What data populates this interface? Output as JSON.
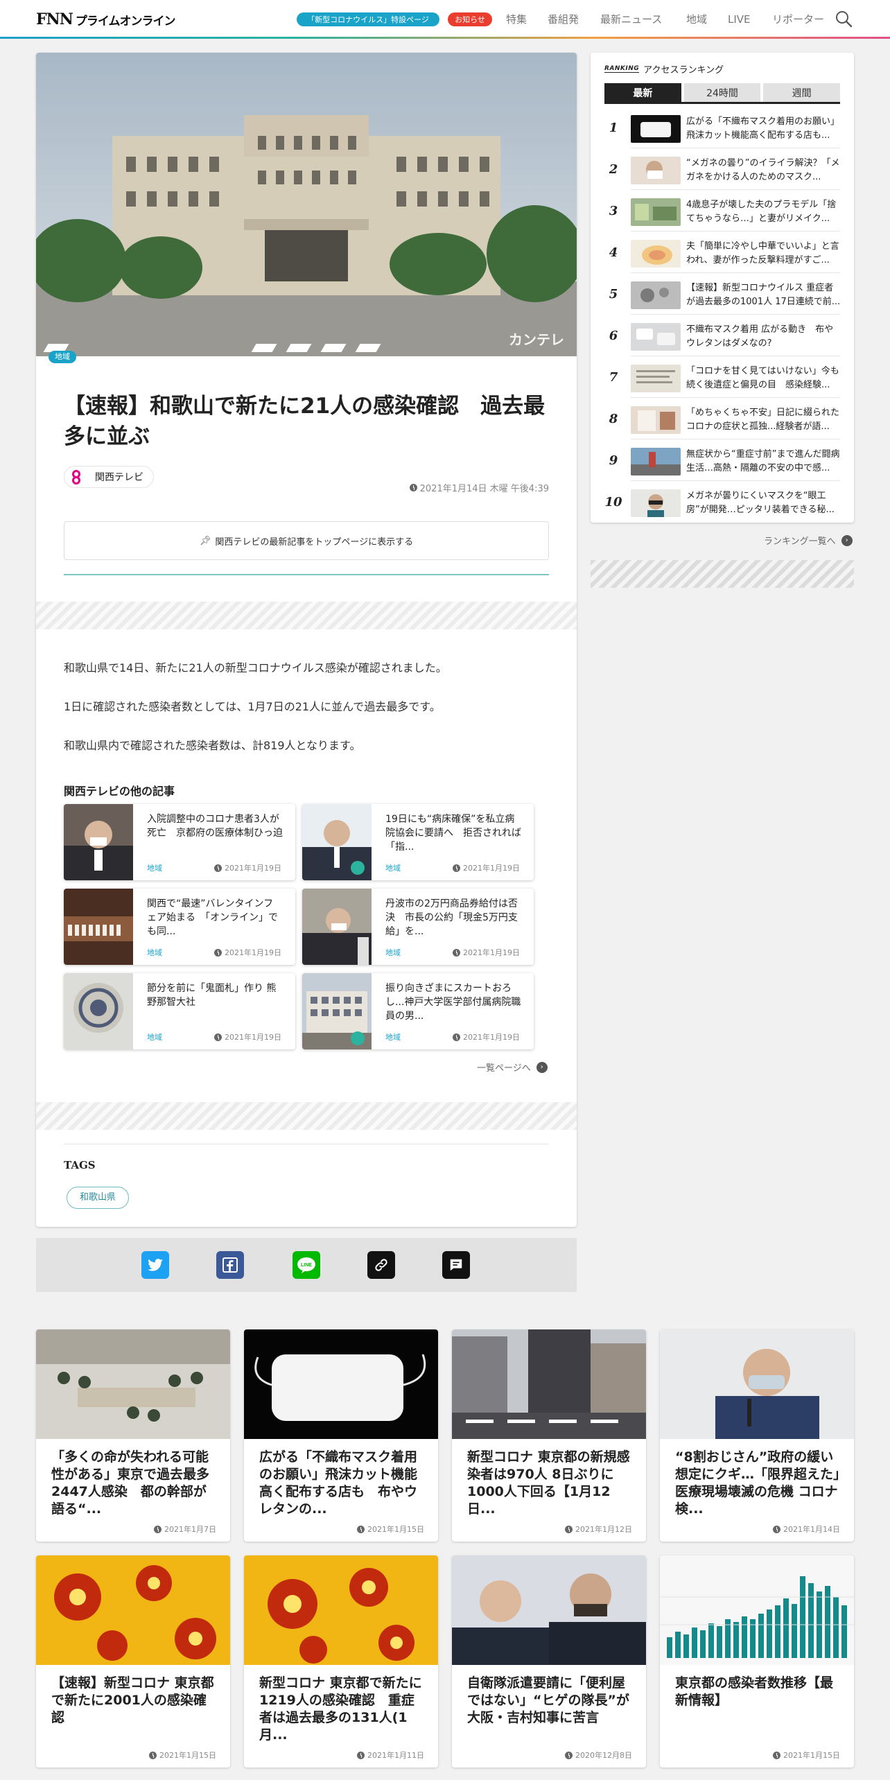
{
  "header": {
    "logo_fnn": "FNN",
    "logo_name": "プライムオンライン",
    "corona_link": "「新型コロナウイルス」特設ページ",
    "notice": "お知らせ",
    "nav": [
      "特集",
      "番組発",
      "最新ニュース",
      "地域",
      "LIVE",
      "リポーター"
    ],
    "search_icon": "search-icon"
  },
  "article": {
    "category": "地域",
    "title": "【速報】和歌山で新たに21人の感染確認　過去最多に並ぶ",
    "source": "関西テレビ",
    "date": "2021年1月14日 木曜 午後4:39",
    "follow_button": "関西テレビの最新記事をトップページに表示する",
    "paragraphs": [
      "和歌山県で14日、新たに21人の新型コロナウイルス感染が確認されました。",
      "1日に確認された感染者数としては、1月7日の21人に並んで過去最多です。",
      "和歌山県内で確認された感染者数は、計819人となります。"
    ],
    "hero_watermark": "カンテレ"
  },
  "related": {
    "heading": "関西テレビの他の記事",
    "items": [
      {
        "title": "入院調整中のコロナ患者3人が死亡　京都府の医療体制ひっ迫",
        "category": "地域",
        "date": "2021年1月19日"
      },
      {
        "title": "19日にも“病床確保”を私立病院協会に要請へ　拒否されれば「指...",
        "category": "地域",
        "date": "2021年1月19日"
      },
      {
        "title": "関西で“最速”バレンタインフェア始まる　「オンライン」でも同...",
        "category": "地域",
        "date": "2021年1月19日"
      },
      {
        "title": "丹波市の2万円商品券給付は否決　市長の公約「現金5万円支給」を...",
        "category": "地域",
        "date": "2021年1月19日"
      },
      {
        "title": "節分を前に「鬼面札」作り 熊野那智大社",
        "category": "地域",
        "date": "2021年1月19日"
      },
      {
        "title": "振り向きざまにスカートおろし...神戸大学医学部付属病院職員の男...",
        "category": "地域",
        "date": "2021年1月19日"
      }
    ],
    "more": "一覧ページへ"
  },
  "tags": {
    "heading": "TAGS",
    "items": [
      "和歌山県"
    ]
  },
  "share": {
    "buttons": [
      "twitter-icon",
      "facebook-icon",
      "line-icon",
      "link-icon",
      "comment-icon"
    ],
    "line_label": "LINE"
  },
  "ranking": {
    "heading_en": "RANKING",
    "heading": "アクセスランキング",
    "tabs": [
      "最新",
      "24時間",
      "週間"
    ],
    "active_tab": "最新",
    "items": [
      {
        "rank": "1",
        "title": "広がる「不織布マスク着用のお願い」飛沫カット機能高く配布する店も..."
      },
      {
        "rank": "2",
        "title": "“メガネの曇り”のイライラ解決？「メガネをかける人のためのマスク..."
      },
      {
        "rank": "3",
        "title": "4歳息子が壊した夫のプラモデル「捨てちゃうなら…」と妻がリメイク..."
      },
      {
        "rank": "4",
        "title": "夫「簡単に冷やし中華でいいよ」と言われ、妻が作った反撃料理がすご..."
      },
      {
        "rank": "5",
        "title": "【速報】新型コロナウイルス 重症者が過去最多の1001人 17日連続で前..."
      },
      {
        "rank": "6",
        "title": "不織布マスク着用 広がる動き　布やウレタンはダメなの?"
      },
      {
        "rank": "7",
        "title": "「コロナを甘く見てはいけない」今も続く後遺症と偏見の目　感染経験..."
      },
      {
        "rank": "8",
        "title": "「めちゃくちゃ不安」日記に綴られたコロナの症状と孤独...経験者が語..."
      },
      {
        "rank": "9",
        "title": "無症状から“重症寸前”まで進んだ闘病生活…高熱・隔離の不安の中で感..."
      },
      {
        "rank": "10",
        "title": "メガネが曇りにくいマスクを“眼工房”が開発…ピッタリ装着できる秘..."
      }
    ],
    "more": "ランキング一覧へ"
  },
  "bottom_cards": [
    {
      "title": "「多くの命が失われる可能性がある」東京で過去最多2447人感染　都の幹部が語る“...",
      "date": "2021年1月7日"
    },
    {
      "title": "広がる「不織布マスク着用のお願い」飛沫カット機能高く配布する店も　布やウレタンの...",
      "date": "2021年1月15日"
    },
    {
      "title": "新型コロナ 東京都の新規感染者は970人 8日ぶりに1000人下回る【1月12日...",
      "date": "2021年1月12日"
    },
    {
      "title": "“8割おじさん”政府の緩い想定にクギ…「限界超えた」医療現場壊滅の危機 コロナ検...",
      "date": "2021年1月14日"
    },
    {
      "title": "【速報】新型コロナ 東京都で新たに2001人の感染確認",
      "date": "2021年1月15日"
    },
    {
      "title": "新型コロナ 東京都で新たに1219人の感染確認　重症者は過去最多の131人(1月...",
      "date": "2021年1月11日"
    },
    {
      "title": "自衛隊派遣要請に「便利屋ではない」“ヒゲの隊長”が大阪・吉村知事に苦言",
      "date": "2020年12月8日"
    },
    {
      "title": "東京都の感染者数推移【最新情報】",
      "date": "2021年1月15日"
    }
  ],
  "colors": {
    "accent": "#19a3c9",
    "notice": "#ea3c2f",
    "twitter": "#1da1f2",
    "facebook": "#3b5998",
    "line": "#00b900"
  }
}
